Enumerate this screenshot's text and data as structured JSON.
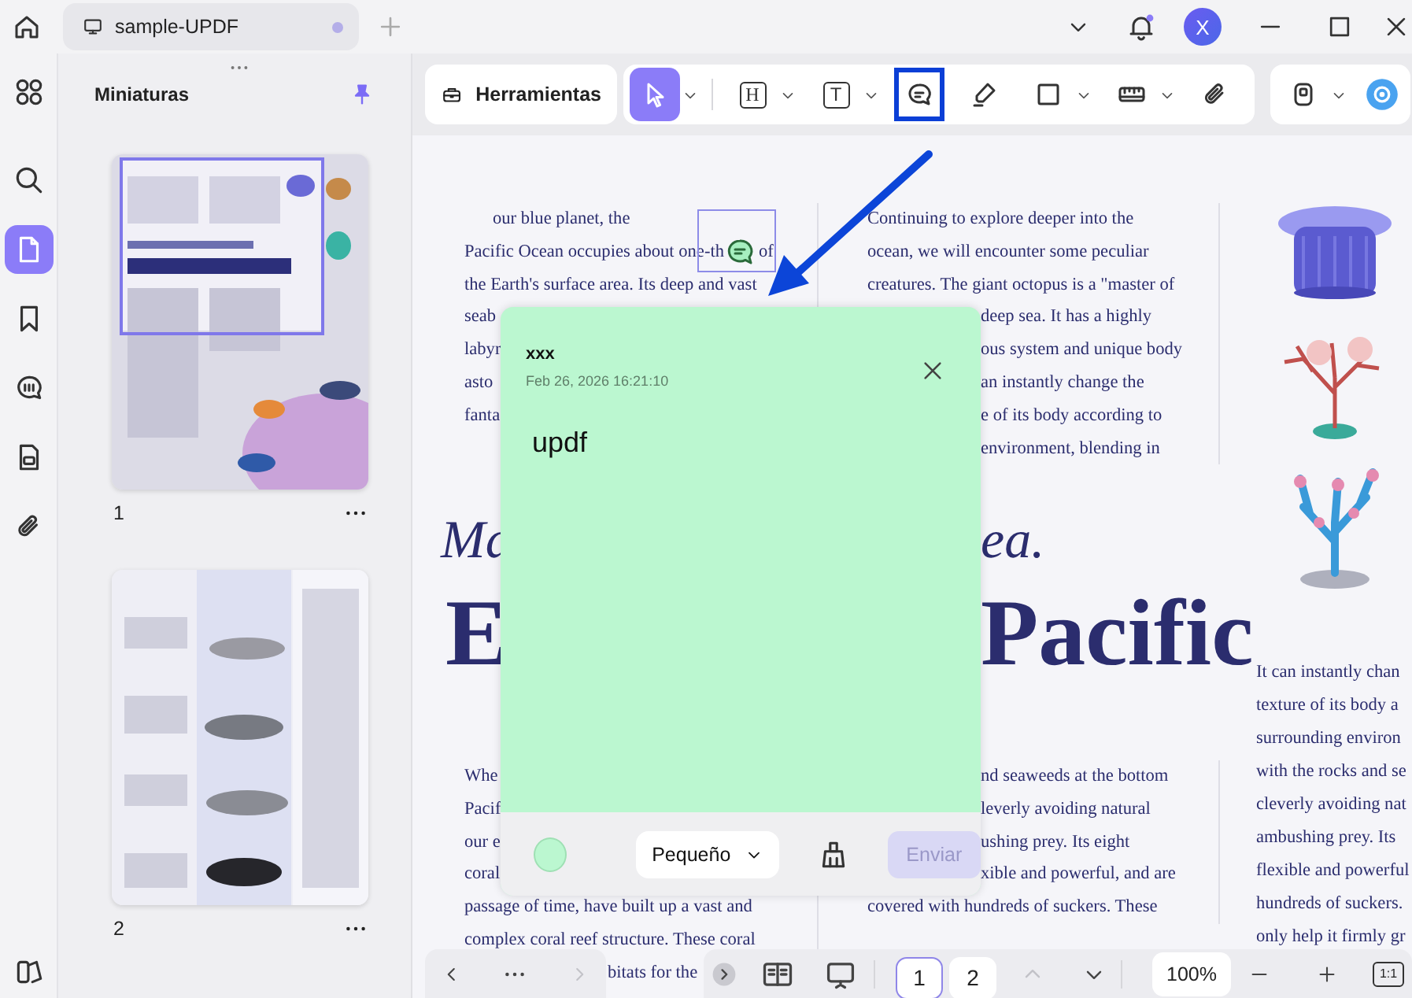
{
  "titlebar": {
    "tab": {
      "title": "sample-UPDF",
      "modified": true
    },
    "account": "X"
  },
  "rail": {
    "items": [
      {
        "kind": "apps",
        "selected": false
      },
      {
        "kind": "search",
        "selected": false
      },
      {
        "kind": "thumbnails",
        "selected": true
      },
      {
        "kind": "bookmarks",
        "selected": false
      },
      {
        "kind": "comments",
        "selected": false
      },
      {
        "kind": "forms",
        "selected": false
      },
      {
        "kind": "attachments",
        "selected": false
      }
    ]
  },
  "sidebar": {
    "title": "Miniaturas",
    "pinned": true,
    "pages": [
      {
        "label": "1",
        "selected": true
      },
      {
        "label": "2",
        "selected": false
      }
    ]
  },
  "toolbar": {
    "tools_button": "Herramientas",
    "tools": [
      {
        "kind": "select",
        "selected": true,
        "menu": true,
        "callout": false
      },
      {
        "kind": "heading",
        "label": "H",
        "selected": false,
        "menu": true,
        "callout": false
      },
      {
        "kind": "textbox",
        "label": "T",
        "selected": false,
        "menu": true,
        "callout": false
      },
      {
        "kind": "comment",
        "selected": false,
        "menu": false,
        "callout": true
      },
      {
        "kind": "pen",
        "selected": false,
        "menu": false,
        "callout": false
      },
      {
        "kind": "shape",
        "selected": false,
        "menu": true,
        "callout": false
      },
      {
        "kind": "measure",
        "selected": false,
        "menu": true,
        "callout": false
      },
      {
        "kind": "attach",
        "selected": false,
        "menu": false,
        "callout": false
      }
    ],
    "extras": [
      {
        "kind": "stamp",
        "menu": true
      },
      {
        "kind": "ai",
        "menu": false
      }
    ]
  },
  "document": {
    "column_1_top": [
      {
        "text": "our blue planet, the",
        "kind": "tail"
      },
      {
        "text": "Pacific Ocean occupies about one-th",
        "rest": "of",
        "kind": "full"
      },
      {
        "text": "the Earth's surface area. Its deep and vast",
        "kind": "full"
      },
      {
        "text": "seab",
        "kind": "full"
      },
      {
        "text": "labyr",
        "kind": "full"
      },
      {
        "text": "asto",
        "kind": "full"
      },
      {
        "text": "fanta",
        "kind": "full"
      }
    ],
    "column_2_top": [
      {
        "text": "Continuing to explore deeper into the",
        "kind": "full"
      },
      {
        "text": "ocean, we will encounter some peculiar",
        "kind": "full"
      },
      {
        "text": "creatures. The giant octopus is a \"master of",
        "kind": "full"
      },
      {
        "text": "deep sea. It has a highly",
        "kind": "after_note"
      },
      {
        "text": "ous system and unique body",
        "kind": "after_note"
      },
      {
        "text": "an instantly change the",
        "kind": "after_note"
      },
      {
        "text": "e of its body according to",
        "kind": "after_note"
      },
      {
        "text": "environment, blending in",
        "kind": "after_note"
      }
    ],
    "title": [
      {
        "kind": "subtitle",
        "head": "Ma",
        "tail": "ea."
      },
      {
        "kind": "headline",
        "head": "E",
        "tail": "Pacific"
      }
    ],
    "column_3": [
      {
        "text": "It can instantly chan"
      },
      {
        "text": "texture of its body a"
      },
      {
        "text": "surrounding environ"
      },
      {
        "text": "with the rocks and se"
      },
      {
        "text": "cleverly avoiding nat"
      },
      {
        "text": "ambushing prey. Its"
      },
      {
        "text": "flexible and powerful"
      },
      {
        "text": "hundreds of suckers."
      },
      {
        "text": "only help it firmly gr"
      }
    ],
    "column_1_bottom": [
      {
        "text": "Whe",
        "kind": "full"
      },
      {
        "text": "Pacif",
        "kind": "full"
      },
      {
        "text": "our e",
        "kind": "full"
      },
      {
        "text": "coral",
        "kind": "full"
      },
      {
        "text": "passage of time, have built up a vast and",
        "kind": "full"
      },
      {
        "text": "complex coral reef structure. These coral",
        "kind": "full"
      },
      {
        "text": "bitats for the",
        "kind": "after_nav"
      }
    ],
    "column_2_bottom": [
      {
        "text": "nd seaweeds at the bottom",
        "kind": "after_note"
      },
      {
        "text": "leverly avoiding natural",
        "kind": "after_note"
      },
      {
        "text": "ushing prey. Its eight",
        "kind": "after_note"
      },
      {
        "text": "xible and powerful, and are",
        "kind": "after_note"
      },
      {
        "text": "covered with hundreds of suckers. These",
        "kind": "full"
      }
    ]
  },
  "note": {
    "author": "xxx",
    "date": "Feb 26, 2026 16:21:10",
    "text": "updf",
    "color": "#bbf7d0",
    "size": "Pequeño",
    "send": {
      "label": "Enviar",
      "disabled": true
    }
  },
  "bottom_bar": {
    "back": {
      "disabled": false
    },
    "forward": {
      "disabled": true
    },
    "pages": [
      {
        "label": "1",
        "selected": true
      },
      {
        "label": "2",
        "selected": false
      }
    ],
    "page_up": {
      "disabled": true
    },
    "page_down": {
      "disabled": false
    },
    "zoom": "100%",
    "actual_size": "1:1"
  }
}
